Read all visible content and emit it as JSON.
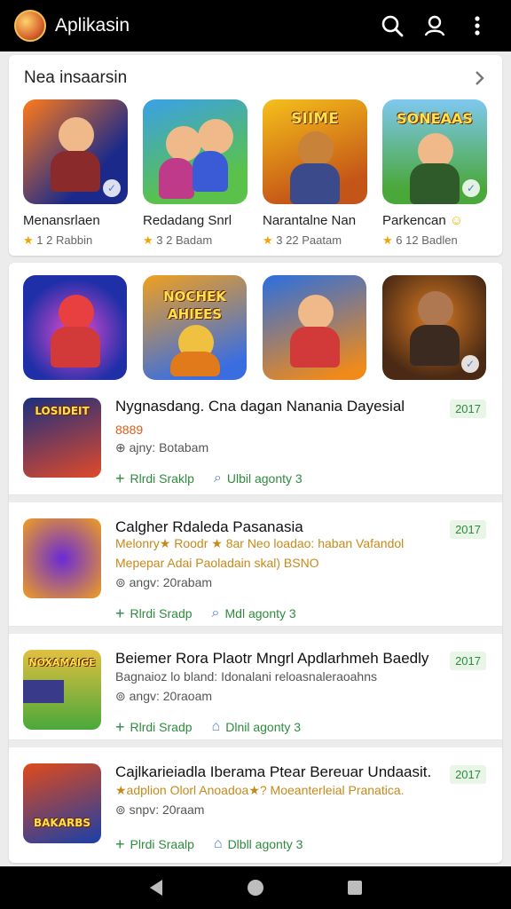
{
  "appbar": {
    "title": "Aplikasin",
    "icons": [
      "search-icon",
      "account-icon",
      "more-vert-icon"
    ]
  },
  "section1": {
    "title": "Nea insaarsin",
    "apps": [
      {
        "name": "Menansrlaen",
        "rating": "1 2",
        "meta": "Rabbin",
        "icon_text": "",
        "colors": [
          "#1b2a8a",
          "#ff6a1a"
        ]
      },
      {
        "name": "Redadang Snrl",
        "rating": "3 2",
        "meta": "Badam",
        "icon_text": "",
        "colors": [
          "#3aa0e8",
          "#5ac24a"
        ]
      },
      {
        "name": "Narantalne Nan",
        "rating": "3 22",
        "meta": "Paatam",
        "icon_text": "SIIME",
        "colors": [
          "#f5a11a",
          "#c45518"
        ]
      },
      {
        "name": "Parkencan",
        "rating": "6 12",
        "meta": "Badlen",
        "icon_text": "SONEAAS",
        "colors": [
          "#7ec8f0",
          "#4aa83a"
        ]
      }
    ]
  },
  "section2": {
    "icons": [
      {
        "name": "featured-app-1",
        "text": "",
        "colors": [
          "#1e2fa8",
          "#e84bd0"
        ]
      },
      {
        "name": "featured-app-2",
        "text": "NOCHEK AHIEES",
        "colors": [
          "#f0a020",
          "#3a6ee0"
        ]
      },
      {
        "name": "featured-app-3",
        "text": "",
        "colors": [
          "#2a6fe0",
          "#f08a1a"
        ]
      },
      {
        "name": "featured-app-4",
        "text": "",
        "colors": [
          "#4a2a14",
          "#d97a22"
        ]
      }
    ],
    "list": [
      {
        "title": "Nygnasdang. Cna dagan Nanania Dayesial",
        "rating_line": "8889",
        "desc_line": "",
        "sub_line": "ajny: Botabam",
        "year": "2017",
        "action1": "Rlrdi Sraklp",
        "action2": "Ulbil agonty 3",
        "icon_text": "LOSIDEIT",
        "colors": [
          "#1a2f80",
          "#e04a2a"
        ]
      },
      {
        "title": "Calgher Rdaleda Pasanasia",
        "rating_line": "Melonry★ Roodr ★ 8ar Neo loadao: haban Vafandol",
        "desc_line": "Mepepar Adai Paoladain skal) BSNO",
        "sub_line": "angv: 20rabam",
        "year": "2017",
        "action1": "Rlrdi Sradp",
        "action2": "Mdl agonty 3",
        "icon_text": "",
        "colors": [
          "#6a2ad6",
          "#f0a020"
        ]
      },
      {
        "title": "Beiemer Rora Plaotr Mngrl Apdlarhmeh Baedly",
        "rating_line": "",
        "desc_line": "Bagnaioz lo bland: Idonalani reloasnaleraoahns",
        "sub_line": "angv: 20raoam",
        "year": "2017",
        "action1": "Rlrdi Sradp",
        "action2": "Dlnil agonty 3",
        "icon_text": "NOXAMAIGE",
        "colors": [
          "#e0c040",
          "#4aa83a"
        ]
      },
      {
        "title": "Cajlkarieiadla Iberama Ptear Bereuar Undaasit.",
        "rating_line": "★adplion Olorl Anoadoa★? Moeanterleial Pranatica.",
        "desc_line": "",
        "sub_line": "snpv: 20raam",
        "year": "2017",
        "action1": "Plrdi Sraalp",
        "action2": "Dlbll agonty 3",
        "icon_text": "BAKARBS",
        "colors": [
          "#1a3fa8",
          "#e04a1a"
        ]
      }
    ]
  },
  "navbar": {
    "icons": [
      "back-icon",
      "home-icon",
      "recents-icon"
    ]
  }
}
